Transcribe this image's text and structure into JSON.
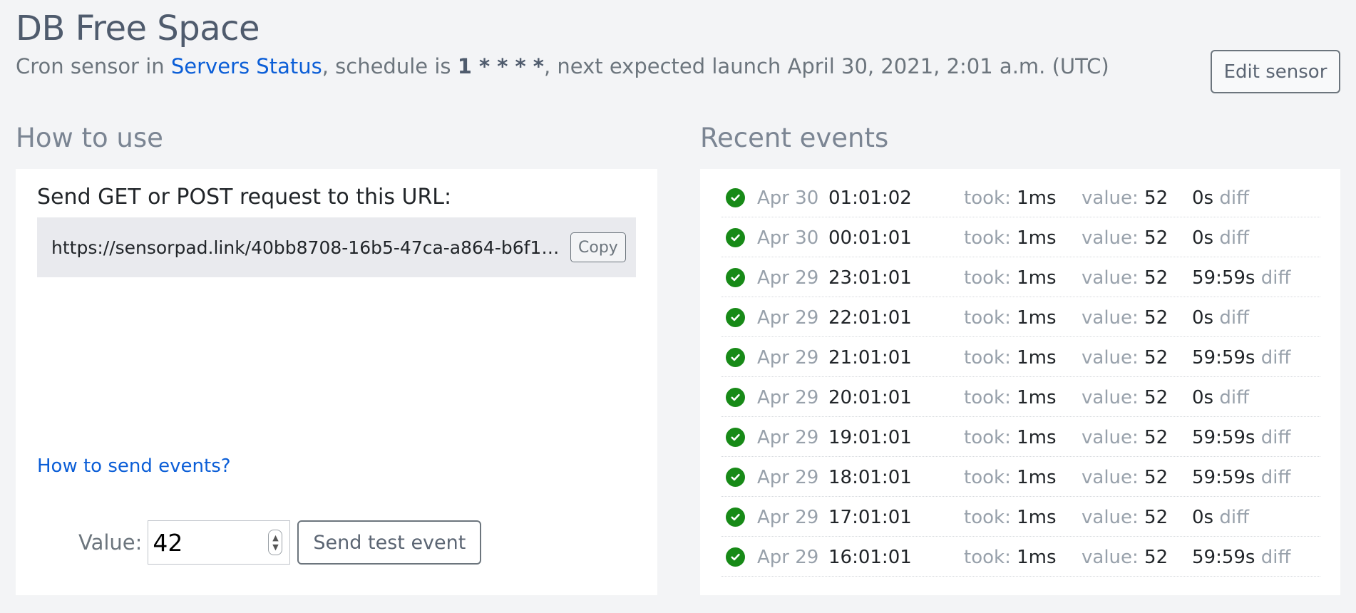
{
  "header": {
    "title": "DB Free Space",
    "subtitle_prefix": "Cron sensor in ",
    "project_link": "Servers Status",
    "subtitle_mid": ", schedule is ",
    "schedule": "1 * * * *",
    "subtitle_suffix": ", next expected launch April 30, 2021, 2:01 a.m. (UTC)",
    "edit_button": "Edit sensor"
  },
  "how_to_use": {
    "title": "How to use",
    "url_label": "Send GET or POST request to this URL:",
    "url": "https://sensorpad.link/40bb8708-16b5-47ca-a864-b6f17d7...",
    "copy_button": "Copy",
    "help_link": "How to send events?",
    "value_label": "Value:",
    "value_input": "42",
    "send_button": "Send test event"
  },
  "recent_events": {
    "title": "Recent events",
    "took_label": "took:",
    "value_label": "value:",
    "diff_label": "diff",
    "rows": [
      {
        "date": "Apr 30",
        "time": "01:01:02",
        "took": "1ms",
        "value": "52",
        "diff": "0s"
      },
      {
        "date": "Apr 30",
        "time": "00:01:01",
        "took": "1ms",
        "value": "52",
        "diff": "0s"
      },
      {
        "date": "Apr 29",
        "time": "23:01:01",
        "took": "1ms",
        "value": "52",
        "diff": "59:59s"
      },
      {
        "date": "Apr 29",
        "time": "22:01:01",
        "took": "1ms",
        "value": "52",
        "diff": "0s"
      },
      {
        "date": "Apr 29",
        "time": "21:01:01",
        "took": "1ms",
        "value": "52",
        "diff": "59:59s"
      },
      {
        "date": "Apr 29",
        "time": "20:01:01",
        "took": "1ms",
        "value": "52",
        "diff": "0s"
      },
      {
        "date": "Apr 29",
        "time": "19:01:01",
        "took": "1ms",
        "value": "52",
        "diff": "59:59s"
      },
      {
        "date": "Apr 29",
        "time": "18:01:01",
        "took": "1ms",
        "value": "52",
        "diff": "59:59s"
      },
      {
        "date": "Apr 29",
        "time": "17:01:01",
        "took": "1ms",
        "value": "52",
        "diff": "0s"
      },
      {
        "date": "Apr 29",
        "time": "16:01:01",
        "took": "1ms",
        "value": "52",
        "diff": "59:59s"
      }
    ]
  },
  "icons": {
    "event_status": "check-circle-icon",
    "event_status_color": "#178a17"
  }
}
